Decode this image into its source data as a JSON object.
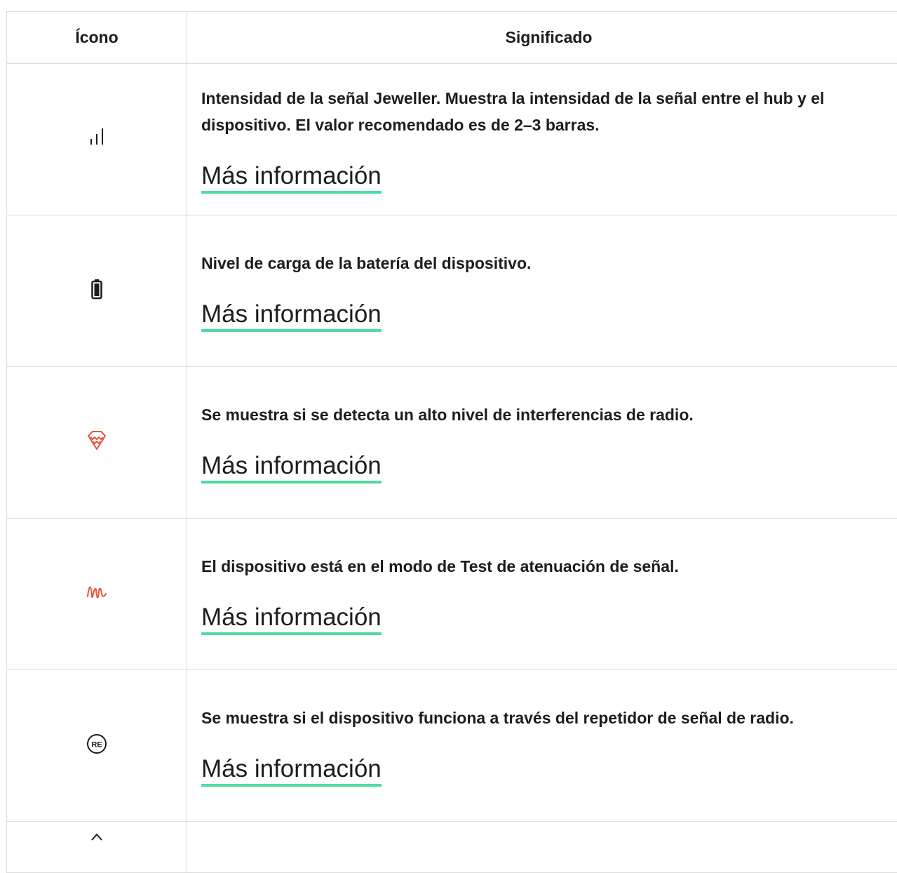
{
  "table": {
    "header": {
      "icon": "Ícono",
      "meaning": "Significado"
    },
    "rows": [
      {
        "icon": "signal-strength-icon",
        "text": "Intensidad de la señal Jeweller. Muestra la intensidad de la señal entre el hub y el dispositivo. El valor recomendado es de 2–3 barras.",
        "link": "Más información"
      },
      {
        "icon": "battery-icon",
        "text": "Nivel de carga de la batería del dispositivo.",
        "link": "Más información"
      },
      {
        "icon": "radio-interference-icon",
        "text": "Se muestra si se detecta un alto nivel de interferencias de radio.",
        "link": "Más información"
      },
      {
        "icon": "attenuation-test-icon",
        "text": "El dispositivo está en el modo de Test de atenuación de señal.",
        "link": "Más información"
      },
      {
        "icon": "repeater-icon",
        "text": "Se muestra si el dispositivo funciona a través del repetidor de señal de radio.",
        "link": "Más información"
      }
    ]
  },
  "colors": {
    "link_underline": "#4fdca0",
    "accent_red": "#e8553f",
    "border": "#dcdcdc",
    "text": "#1d1d1f"
  }
}
